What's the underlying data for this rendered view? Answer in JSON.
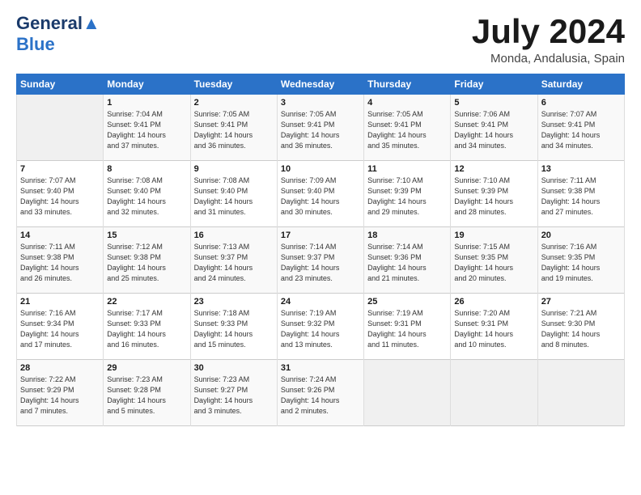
{
  "logo": {
    "line1": "General",
    "line2": "Blue"
  },
  "title": "July 2024",
  "location": "Monda, Andalusia, Spain",
  "days_header": [
    "Sunday",
    "Monday",
    "Tuesday",
    "Wednesday",
    "Thursday",
    "Friday",
    "Saturday"
  ],
  "weeks": [
    [
      {
        "num": "",
        "info": ""
      },
      {
        "num": "1",
        "info": "Sunrise: 7:04 AM\nSunset: 9:41 PM\nDaylight: 14 hours\nand 37 minutes."
      },
      {
        "num": "2",
        "info": "Sunrise: 7:05 AM\nSunset: 9:41 PM\nDaylight: 14 hours\nand 36 minutes."
      },
      {
        "num": "3",
        "info": "Sunrise: 7:05 AM\nSunset: 9:41 PM\nDaylight: 14 hours\nand 36 minutes."
      },
      {
        "num": "4",
        "info": "Sunrise: 7:05 AM\nSunset: 9:41 PM\nDaylight: 14 hours\nand 35 minutes."
      },
      {
        "num": "5",
        "info": "Sunrise: 7:06 AM\nSunset: 9:41 PM\nDaylight: 14 hours\nand 34 minutes."
      },
      {
        "num": "6",
        "info": "Sunrise: 7:07 AM\nSunset: 9:41 PM\nDaylight: 14 hours\nand 34 minutes."
      }
    ],
    [
      {
        "num": "7",
        "info": "Sunrise: 7:07 AM\nSunset: 9:40 PM\nDaylight: 14 hours\nand 33 minutes."
      },
      {
        "num": "8",
        "info": "Sunrise: 7:08 AM\nSunset: 9:40 PM\nDaylight: 14 hours\nand 32 minutes."
      },
      {
        "num": "9",
        "info": "Sunrise: 7:08 AM\nSunset: 9:40 PM\nDaylight: 14 hours\nand 31 minutes."
      },
      {
        "num": "10",
        "info": "Sunrise: 7:09 AM\nSunset: 9:40 PM\nDaylight: 14 hours\nand 30 minutes."
      },
      {
        "num": "11",
        "info": "Sunrise: 7:10 AM\nSunset: 9:39 PM\nDaylight: 14 hours\nand 29 minutes."
      },
      {
        "num": "12",
        "info": "Sunrise: 7:10 AM\nSunset: 9:39 PM\nDaylight: 14 hours\nand 28 minutes."
      },
      {
        "num": "13",
        "info": "Sunrise: 7:11 AM\nSunset: 9:38 PM\nDaylight: 14 hours\nand 27 minutes."
      }
    ],
    [
      {
        "num": "14",
        "info": "Sunrise: 7:11 AM\nSunset: 9:38 PM\nDaylight: 14 hours\nand 26 minutes."
      },
      {
        "num": "15",
        "info": "Sunrise: 7:12 AM\nSunset: 9:38 PM\nDaylight: 14 hours\nand 25 minutes."
      },
      {
        "num": "16",
        "info": "Sunrise: 7:13 AM\nSunset: 9:37 PM\nDaylight: 14 hours\nand 24 minutes."
      },
      {
        "num": "17",
        "info": "Sunrise: 7:14 AM\nSunset: 9:37 PM\nDaylight: 14 hours\nand 23 minutes."
      },
      {
        "num": "18",
        "info": "Sunrise: 7:14 AM\nSunset: 9:36 PM\nDaylight: 14 hours\nand 21 minutes."
      },
      {
        "num": "19",
        "info": "Sunrise: 7:15 AM\nSunset: 9:35 PM\nDaylight: 14 hours\nand 20 minutes."
      },
      {
        "num": "20",
        "info": "Sunrise: 7:16 AM\nSunset: 9:35 PM\nDaylight: 14 hours\nand 19 minutes."
      }
    ],
    [
      {
        "num": "21",
        "info": "Sunrise: 7:16 AM\nSunset: 9:34 PM\nDaylight: 14 hours\nand 17 minutes."
      },
      {
        "num": "22",
        "info": "Sunrise: 7:17 AM\nSunset: 9:33 PM\nDaylight: 14 hours\nand 16 minutes."
      },
      {
        "num": "23",
        "info": "Sunrise: 7:18 AM\nSunset: 9:33 PM\nDaylight: 14 hours\nand 15 minutes."
      },
      {
        "num": "24",
        "info": "Sunrise: 7:19 AM\nSunset: 9:32 PM\nDaylight: 14 hours\nand 13 minutes."
      },
      {
        "num": "25",
        "info": "Sunrise: 7:19 AM\nSunset: 9:31 PM\nDaylight: 14 hours\nand 11 minutes."
      },
      {
        "num": "26",
        "info": "Sunrise: 7:20 AM\nSunset: 9:31 PM\nDaylight: 14 hours\nand 10 minutes."
      },
      {
        "num": "27",
        "info": "Sunrise: 7:21 AM\nSunset: 9:30 PM\nDaylight: 14 hours\nand 8 minutes."
      }
    ],
    [
      {
        "num": "28",
        "info": "Sunrise: 7:22 AM\nSunset: 9:29 PM\nDaylight: 14 hours\nand 7 minutes."
      },
      {
        "num": "29",
        "info": "Sunrise: 7:23 AM\nSunset: 9:28 PM\nDaylight: 14 hours\nand 5 minutes."
      },
      {
        "num": "30",
        "info": "Sunrise: 7:23 AM\nSunset: 9:27 PM\nDaylight: 14 hours\nand 3 minutes."
      },
      {
        "num": "31",
        "info": "Sunrise: 7:24 AM\nSunset: 9:26 PM\nDaylight: 14 hours\nand 2 minutes."
      },
      {
        "num": "",
        "info": ""
      },
      {
        "num": "",
        "info": ""
      },
      {
        "num": "",
        "info": ""
      }
    ]
  ]
}
